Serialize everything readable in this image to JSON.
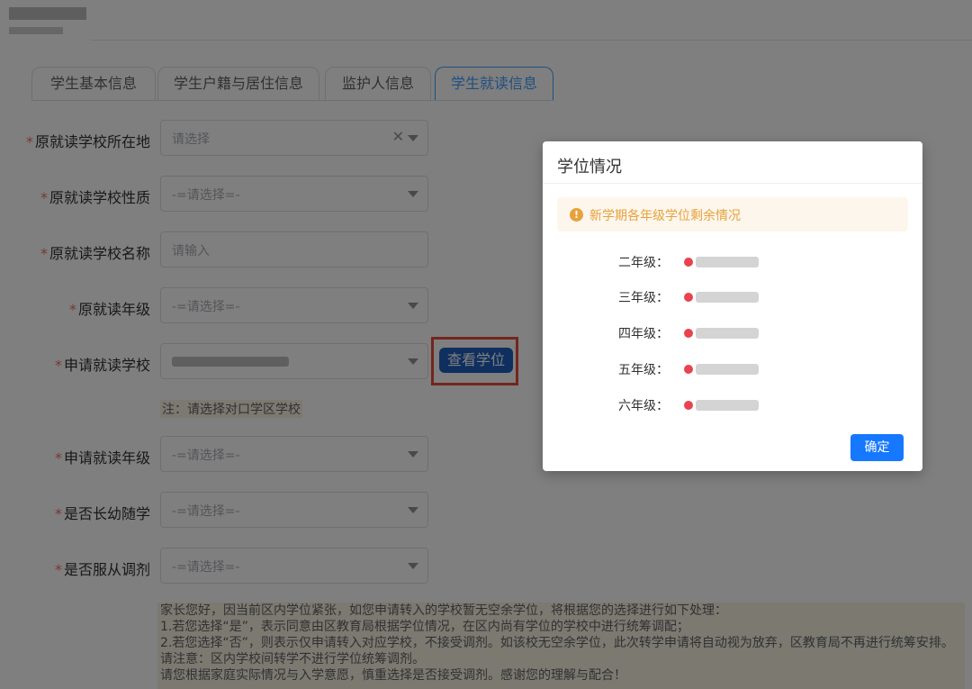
{
  "tabs": [
    "学生基本信息",
    "学生户籍与居住信息",
    "监护人信息",
    "学生就读信息"
  ],
  "active_tab_index": 3,
  "form": {
    "fields": [
      {
        "label": "原就读学校所在地",
        "placeholder": "请选择"
      },
      {
        "label": "原就读学校性质",
        "placeholder": "-=请选择=-"
      },
      {
        "label": "原就读学校名称",
        "placeholder": "请输入"
      },
      {
        "label": "原就读年级",
        "placeholder": "-=请选择=-"
      },
      {
        "label": "申请就读学校",
        "placeholder": ""
      },
      {
        "label": "申请就读年级",
        "placeholder": "-=请选择=-"
      },
      {
        "label": "是否长幼随学",
        "placeholder": "-=请选择=-"
      },
      {
        "label": "是否服从调剂",
        "placeholder": "-=请选择=-"
      }
    ],
    "required_mark": "*",
    "check_button": "查看学位",
    "note": "注：请选择对口学区学校"
  },
  "notice_lines": [
    "家长您好，因当前区内学位紧张，如您申请转入的学校暂无空余学位，将根据您的选择进行如下处理：",
    "1.若您选择“是”，表示同意由区教育局根据学位情况，在区内尚有学位的学校中进行统筹调配；",
    "2.若您选择“否”，则表示仅申请转入对应学校，不接受调剂。如该校无空余学位，此次转学申请将自动视为放弃，区教育局不再进行统筹安排。",
    "请注意：区内学校间转学不进行学位统筹调剂。",
    "请您根据家庭实际情况与入学意愿，慎重选择是否接受调剂。感谢您的理解与配合！"
  ],
  "dialog": {
    "title": "学位情况",
    "alert": "新学期各年级学位剩余情况",
    "grades": [
      "二年级：",
      "三年级：",
      "四年级：",
      "五年级：",
      "六年级："
    ],
    "confirm": "确定"
  },
  "colors": {
    "primary": "#409eff",
    "required": "#f56c6c",
    "warning": "#e6a23c",
    "highlight_box": "#e74c3c"
  }
}
